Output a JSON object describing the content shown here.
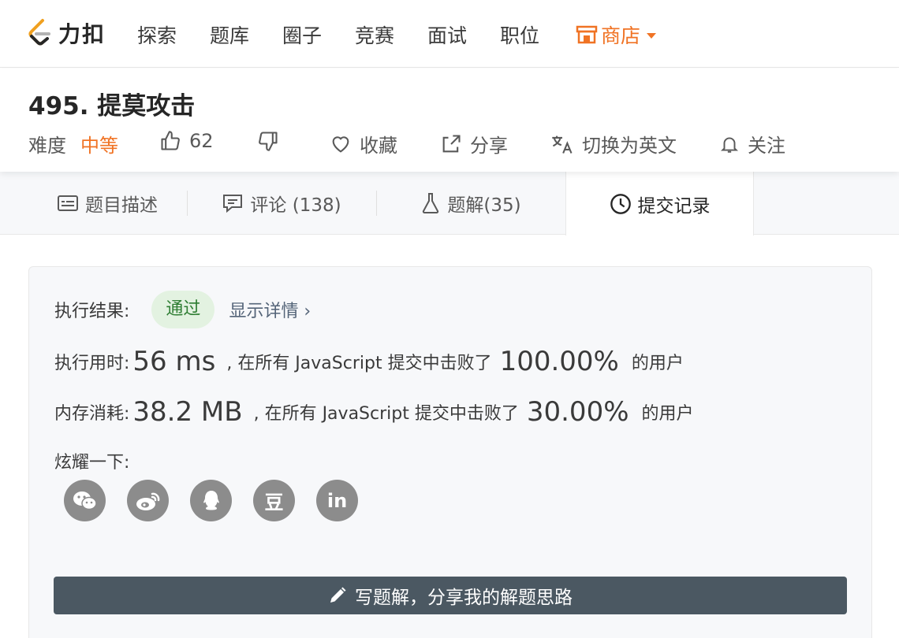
{
  "nav": {
    "logo_text": "力扣",
    "items": [
      "探索",
      "题库",
      "圈子",
      "竞赛",
      "面试",
      "职位"
    ],
    "store_label": "商店"
  },
  "question": {
    "title": "495. 提莫攻击",
    "difficulty_label": "难度",
    "difficulty_value": "中等",
    "likes": "62",
    "favorite_label": "收藏",
    "share_label": "分享",
    "translate_label": "切换为英文",
    "follow_label": "关注"
  },
  "tabs": {
    "description": "题目描述",
    "comments": "评论 (138)",
    "solutions": "题解(35)",
    "submissions": "提交记录"
  },
  "result": {
    "exec_label": "执行结果:",
    "status": "通过",
    "detail_link": "显示详情 ›",
    "time_label": "执行用时:",
    "time_value": "56 ms",
    "time_text": ", 在所有 JavaScript 提交中击败了",
    "time_percent": "100.00%",
    "time_suffix": "的用户",
    "mem_label": "内存消耗:",
    "mem_value": "38.2 MB",
    "mem_text": ", 在所有 JavaScript 提交中击败了",
    "mem_percent": "30.00%",
    "mem_suffix": "的用户",
    "share_label": "炫耀一下:",
    "share_buttons": [
      {
        "icon": "wechat-icon",
        "glyph": ""
      },
      {
        "icon": "weibo-icon",
        "glyph": ""
      },
      {
        "icon": "qq-icon",
        "glyph": ""
      },
      {
        "icon": "douban-icon",
        "glyph": "豆"
      },
      {
        "icon": "linkedin-icon",
        "glyph": "in"
      }
    ],
    "write_button": "写题解，分享我的解题思路"
  },
  "colors": {
    "accent": "#f07324",
    "success_bg": "#e3f2e1",
    "success_text": "#2e7d32",
    "dark_button": "#4b5862"
  }
}
